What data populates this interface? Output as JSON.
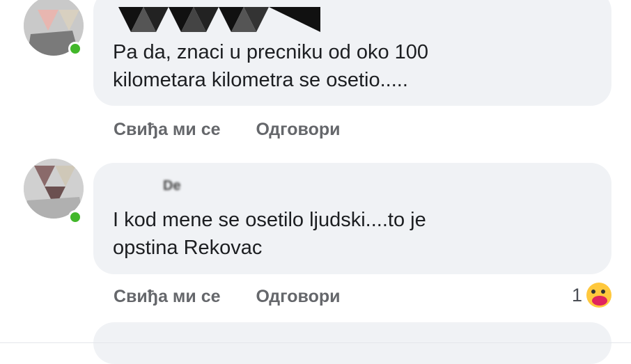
{
  "comments": [
    {
      "author": "",
      "text": "Pa da, znaci u precniku od oko 100\nkilometara kilometra se osetio.....",
      "like_label": "Свиђа ми се",
      "reply_label": "Одговори",
      "reaction_count": ""
    },
    {
      "author": "De",
      "text": "I kod mene se osetilo ljudski....to je\nopstina Rekovac",
      "like_label": "Свиђа ми се",
      "reply_label": "Одговори",
      "reaction_count": "1"
    }
  ],
  "colors": {
    "bubble": "#f0f2f5",
    "online": "#42b72a",
    "action_text": "#65676b"
  },
  "icons": {
    "reaction": "hug-icon"
  }
}
